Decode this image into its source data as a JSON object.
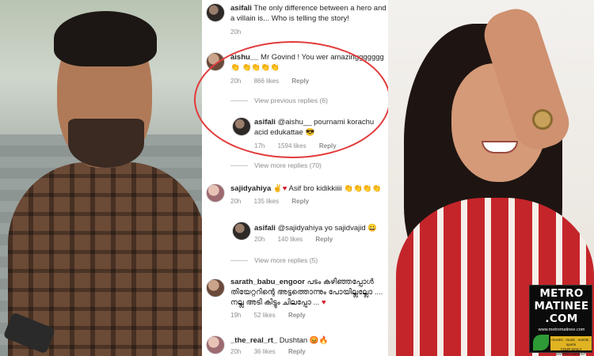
{
  "comments": [
    {
      "username": "asifali",
      "text": "The only difference between a hero and a villain is... Who is telling the story!",
      "time": "20h"
    },
    {
      "username": "aishu__",
      "text": "Mr Govind ! You wer amazinggggggg",
      "emojis": "👏 👏👏👏👏",
      "time": "20h",
      "likes": "866 likes",
      "reply": "Reply",
      "view_previous": "View previous replies (6)"
    },
    {
      "username": "asifali",
      "text": "@aishu__ pournami korachu acid edukattae",
      "emoji": "😎",
      "time": "17h",
      "likes": "1594 likes",
      "reply": "Reply",
      "view_more": "View more replies (70)"
    },
    {
      "username": "sajidyahiya",
      "text_emoji_1": "✌",
      "heart": "♥",
      "text": "Asif bro kidikkiiii",
      "emojis": "👏👏👏👏",
      "time": "20h",
      "likes": "135 likes",
      "reply": "Reply"
    },
    {
      "username": "asifali",
      "text": "@sajidyahiya yo sajidvajid",
      "emoji": "😀",
      "time": "20h",
      "likes": "140 likes",
      "reply": "Reply",
      "view_more": "View more replies (5)"
    },
    {
      "username": "sarath_babu_engoor",
      "text": "പടം കഴിഞ്ഞപ്പോൾ തിയേറ്ററിന്റെ അട്ടത്തൊന്നും പോയില്ലല്ലോ .... നല്ല അടി കിട്ടും ചിലപ്പോ ...",
      "heart": "♥",
      "time": "19h",
      "likes": "52 likes",
      "reply": "Reply"
    },
    {
      "username": "_the_real_rt_",
      "text": "Dushtan",
      "emoji": "😡🔥",
      "time": "20h",
      "likes": "36 likes",
      "reply": "Reply"
    }
  ],
  "logo": {
    "line1": "METRO",
    "line2": "MATINEE",
    "line3": ".COM",
    "url": "www.metromatinee.com",
    "tagline": "movies . music . events . sports",
    "tagline2": "YOUR DAILY ENTERTAINMENT"
  },
  "colors": {
    "highlight": "#e23b3b",
    "username": "#262626",
    "meta": "#8e8e8e"
  }
}
